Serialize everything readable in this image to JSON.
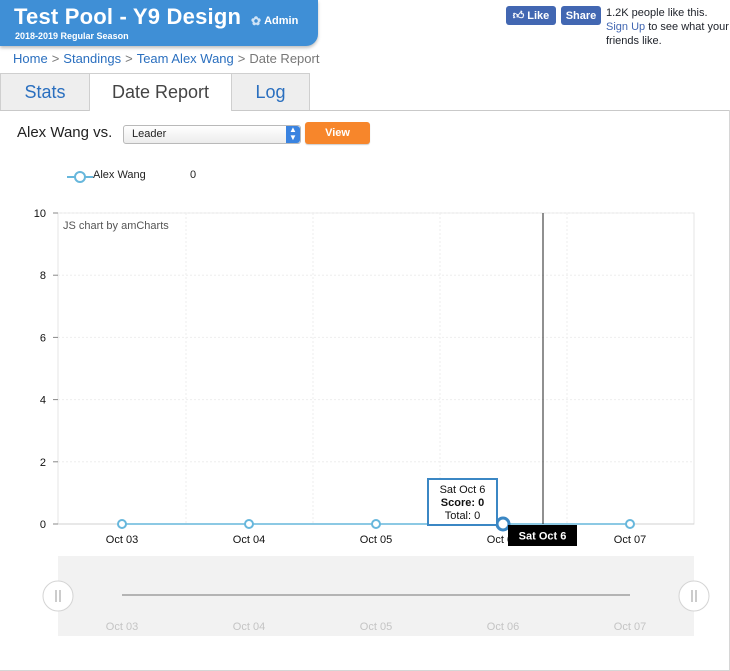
{
  "header": {
    "title": "Test Pool - Y9 Design",
    "season": "2018-2019 Regular Season",
    "admin_label": "Admin",
    "color": "#3f8fd6"
  },
  "facebook": {
    "like_label": "Like",
    "share_label": "Share",
    "count_text": "1.2K people like this.",
    "signup_label": "Sign Up",
    "signup_suffix": " to see what your friends like."
  },
  "breadcrumb": {
    "items": [
      "Home",
      "Standings",
      "Team Alex Wang"
    ],
    "current": "Date Report"
  },
  "tabs": [
    {
      "label": "Stats",
      "active": false
    },
    {
      "label": "Date Report",
      "active": true
    },
    {
      "label": "Log",
      "active": false
    }
  ],
  "controls": {
    "vs_label": "Alex Wang vs.",
    "select_value": "Leader",
    "view_label": "View"
  },
  "legend": {
    "name": "Alex Wang",
    "value": "0"
  },
  "chart_data": {
    "type": "line",
    "credit": "JS chart by amCharts",
    "categories": [
      "Oct 03",
      "Oct 04",
      "Oct 05",
      "Oct 06",
      "Oct 07"
    ],
    "series": [
      {
        "name": "Alex Wang",
        "values": [
          0,
          0,
          0,
          0,
          0
        ],
        "color": "#67b7dc"
      }
    ],
    "y_ticks": [
      0,
      2,
      4,
      6,
      8,
      10
    ],
    "ylim": [
      0,
      10
    ],
    "grid": true,
    "cursor_label": "Sat Oct 6",
    "balloon": {
      "date": "Sat Oct 6",
      "score_label": "Score:",
      "score_value": "0",
      "total_label": "Total:",
      "total_value": "0"
    },
    "scrollbar_labels": [
      "Oct 03",
      "Oct 04",
      "Oct 05",
      "Oct 06",
      "Oct 07"
    ]
  }
}
